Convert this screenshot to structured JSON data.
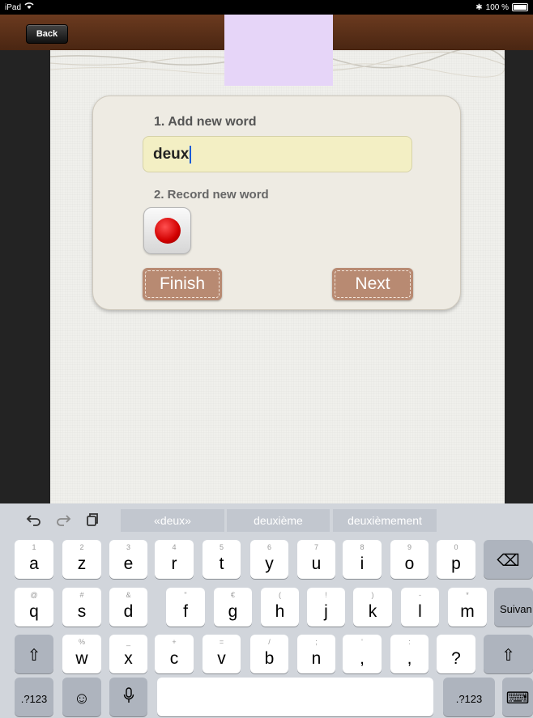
{
  "status_bar": {
    "device": "iPad",
    "wifi_icon": "wifi-icon",
    "bluetooth_icon": "bluetooth-icon",
    "battery": "100 %"
  },
  "nav": {
    "back_label": "Back"
  },
  "form": {
    "step1_label": "1. Add new word",
    "word_value": "deux",
    "step2_label": "2. Record new word",
    "record_icon": "record-icon",
    "finish_label": "Finish",
    "next_label": "Next"
  },
  "keyboard": {
    "toolbar": {
      "undo": "⮌",
      "redo": "⮎",
      "paste": "⧉"
    },
    "suggestions": [
      "«deux»",
      "deuxième",
      "deuxièmement"
    ],
    "row1": [
      {
        "main": "a",
        "sub": "1"
      },
      {
        "main": "z",
        "sub": "2"
      },
      {
        "main": "e",
        "sub": "3"
      },
      {
        "main": "r",
        "sub": "4"
      },
      {
        "main": "t",
        "sub": "5"
      },
      {
        "main": "y",
        "sub": "6"
      },
      {
        "main": "u",
        "sub": "7"
      },
      {
        "main": "i",
        "sub": "8"
      },
      {
        "main": "o",
        "sub": "9"
      },
      {
        "main": "p",
        "sub": "0"
      }
    ],
    "row2": [
      {
        "main": "q",
        "sub": "@"
      },
      {
        "main": "s",
        "sub": "#"
      },
      {
        "main": "d",
        "sub": "&"
      },
      {
        "main": "f",
        "sub": "\""
      },
      {
        "main": "g",
        "sub": "€"
      },
      {
        "main": "h",
        "sub": "("
      },
      {
        "main": "j",
        "sub": "!"
      },
      {
        "main": "k",
        "sub": ")"
      },
      {
        "main": "l",
        "sub": "-"
      },
      {
        "main": "m",
        "sub": "*"
      }
    ],
    "row3": [
      {
        "main": "w",
        "sub": "%"
      },
      {
        "main": "x",
        "sub": "_"
      },
      {
        "main": "c",
        "sub": "+"
      },
      {
        "main": "v",
        "sub": "="
      },
      {
        "main": "b",
        "sub": "/"
      },
      {
        "main": "n",
        "sub": ";"
      },
      {
        "main": ",",
        "sub": "'"
      },
      {
        "main": ",",
        "sub": ":"
      },
      {
        "main": "?",
        "sub": ""
      },
      {
        "main": ".",
        "sub": "'"
      }
    ],
    "return_label": "Suivan",
    "numbers_label": ".?123",
    "delete_icon": "⌫",
    "shift_icon": "⇧",
    "emoji_icon": "☺",
    "mic_icon": "🎙",
    "hide_icon": "⌨"
  }
}
